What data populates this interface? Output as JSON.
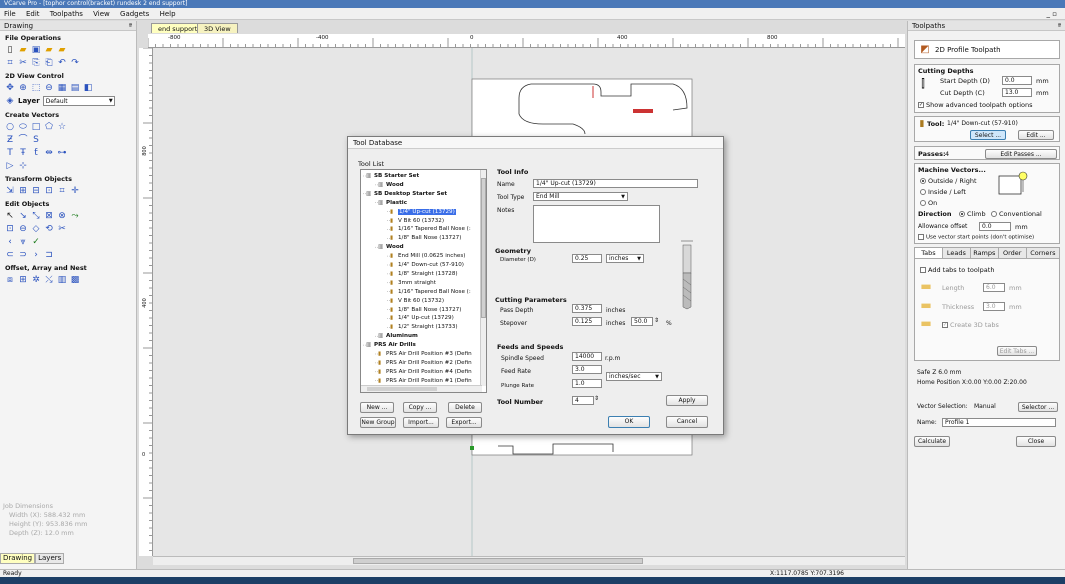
{
  "window": {
    "title": "VCarve Pro - [tophor control(bracket) rundesk 2 end support]"
  },
  "menu": {
    "items": [
      "File",
      "Edit",
      "Toolpaths",
      "View",
      "Gadgets",
      "Help"
    ],
    "winctl": "_ ▫"
  },
  "left_panel": {
    "header": "Drawing",
    "pin": "ª",
    "sections": {
      "file_ops": "File Operations",
      "view2d": "2D View Control",
      "layer_label": "Layer",
      "layer_value": "Default",
      "create_vectors": "Create Vectors",
      "transform": "Transform Objects",
      "edit": "Edit Objects",
      "offset": "Offset, Array and Nest"
    },
    "job": {
      "title": "Job Dimensions",
      "width": "Width  (X): 588.432 mm",
      "height": "Height (Y): 953.836 mm",
      "depth": "Depth  (Z): 12.0 mm"
    },
    "tabs": [
      "Drawing",
      "Layers"
    ]
  },
  "doc_tabs": [
    "end support",
    "3D View"
  ],
  "ruler": {
    "top": [
      "-800",
      "-400",
      "0",
      "400",
      "800"
    ],
    "left": [
      "800",
      "400",
      "0"
    ]
  },
  "right_panel": {
    "header": "Toolpaths",
    "pin": "ª",
    "toolpath_title": "2D Profile Toolpath",
    "cutting_depths": "Cutting Depths",
    "start_depth_label": "Start Depth (D)",
    "start_depth": "0.0",
    "cut_depth_label": "Cut Depth (C)",
    "cut_depth": "13.0",
    "unit": "mm",
    "advanced": "Show advanced toolpath options",
    "tool_label": "Tool:",
    "tool_value": "1/4\" Down-cut (57-910)",
    "select": "Select ...",
    "edit": "Edit ...",
    "passes_label": "Passes:",
    "passes": "4",
    "edit_passes": "Edit Passes ...",
    "machine_vectors": "Machine Vectors...",
    "outside": "Outside / Right",
    "inside": "Inside / Left",
    "on": "On",
    "direction": "Direction",
    "climb": "Climb",
    "conventional": "Conventional",
    "allowance_label": "Allowance offset",
    "allowance": "0.0",
    "vector_start": "Use vector start points (don't optimise)",
    "tabs": [
      "Tabs",
      "Leads",
      "Ramps",
      "Order",
      "Corners"
    ],
    "add_tabs": "Add tabs to toolpath",
    "length_label": "Length",
    "length": "6.0",
    "thickness_label": "Thickness",
    "thickness": "3.0",
    "create3d": "Create 3D tabs",
    "edit_tabs": "Edit Tabs ...",
    "safe_z": "Safe Z      6.0 mm",
    "home": "Home Position  X:0.00 Y:0.00 Z:20.00",
    "vector_sel_label": "Vector Selection:",
    "vector_sel": "Manual",
    "selector": "Selector ...",
    "name_label": "Name:",
    "name": "Profile 1",
    "calculate": "Calculate",
    "close": "Close"
  },
  "dialog": {
    "title": "Tool Database",
    "tool_list": "Tool List",
    "tree": [
      {
        "t": "SB Starter Set",
        "b": true
      },
      {
        "t": "Wood",
        "b": true
      },
      {
        "t": "SB Desktop Starter Set",
        "b": true
      },
      {
        "t": "Plastic",
        "b": true
      },
      {
        "t": "1/4\" Up-cut (13729)",
        "sel": true
      },
      {
        "t": "V Bit 60 (13732)"
      },
      {
        "t": "1/16\" Tapered Ball Nose (:"
      },
      {
        "t": "1/8\" Ball Nose (13727)"
      },
      {
        "t": "Wood",
        "b": true
      },
      {
        "t": "End Mill (0.0625 inches)"
      },
      {
        "t": "1/4\" Down-cut (57-910)"
      },
      {
        "t": "1/8\" Straight (13728)"
      },
      {
        "t": "3mm straight"
      },
      {
        "t": "1/16\" Tapered Ball Nose (:"
      },
      {
        "t": "V Bit 60 (13732)"
      },
      {
        "t": "1/8\" Ball Nose (13727)"
      },
      {
        "t": "1/4\" Up-cut (13729)"
      },
      {
        "t": "1/2\" Straight (13733)"
      },
      {
        "t": "Aluminum",
        "b": true
      },
      {
        "t": "PRS Air Drills",
        "b": true
      },
      {
        "t": "PRS Air Drill Position #3 (Defin"
      },
      {
        "t": "PRS Air Drill Position #2 (Defin"
      },
      {
        "t": "PRS Air Drill Position #4 (Defin"
      },
      {
        "t": "PRS Air Drill Position #1 (Defin"
      }
    ],
    "tool_info": "Tool Info",
    "name_label": "Name",
    "name": "1/4\" Up-cut (13729)",
    "type_label": "Tool Type",
    "type": "End Mill",
    "notes_label": "Notes",
    "geometry": "Geometry",
    "diameter_label": "Diameter (D)",
    "diameter": "0.25",
    "diameter_unit": "inches",
    "cutting_params": "Cutting Parameters",
    "pass_depth_label": "Pass Depth",
    "pass_depth": "0.375",
    "stepover_label": "Stepover",
    "stepover": "0.125",
    "stepover_pct": "50.0",
    "inches": "inches",
    "pct": "%",
    "feeds": "Feeds and Speeds",
    "spindle_label": "Spindle Speed",
    "spindle": "14000",
    "rpm": "r.p.m",
    "feed_label": "Feed Rate",
    "feed": "3.0",
    "plunge_label": "Plunge Rate",
    "plunge": "1.0",
    "rate_unit": "inches/sec",
    "tool_number_label": "Tool Number",
    "tool_number": "4",
    "apply": "Apply",
    "new": "New ...",
    "copy": "Copy ...",
    "delete": "Delete",
    "new_group": "New Group",
    "import": "Import...",
    "export": "Export...",
    "ok": "OK",
    "cancel": "Cancel"
  },
  "status": {
    "ready": "Ready",
    "coords": "X:1117.0785 Y:707.3196"
  }
}
